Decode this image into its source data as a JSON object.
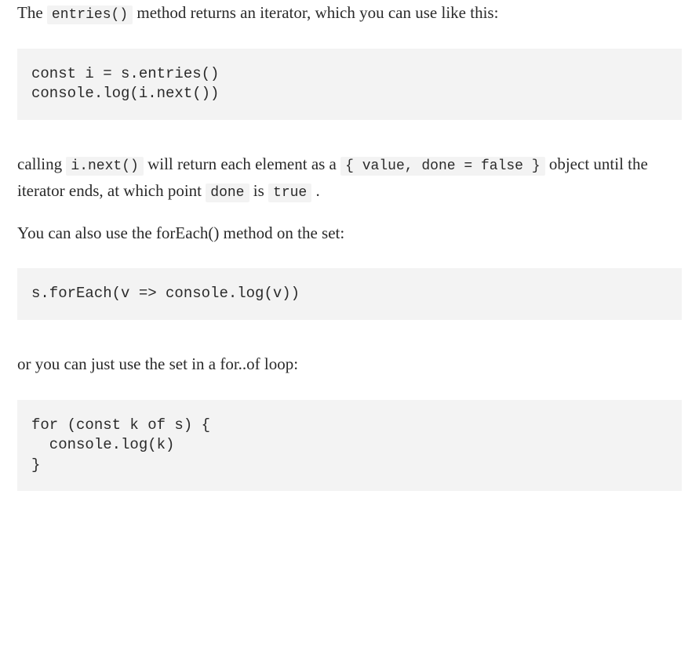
{
  "para1": {
    "text_before": "The ",
    "code1": "entries()",
    "text_after": " method returns an iterator, which you can use like this:"
  },
  "codeblock1": "const i = s.entries()\nconsole.log(i.next())",
  "para2": {
    "text_before": "calling ",
    "code1": "i.next()",
    "text_mid1": " will return each element as a ",
    "code2": "{ value, done = false }",
    "text_mid2": " object until the iterator ends, at which point ",
    "code3": "done",
    "text_mid3": " is ",
    "code4": "true",
    "text_after": " ."
  },
  "para3": "You can also use the forEach() method on the set:",
  "codeblock2": "s.forEach(v => console.log(v))",
  "para4": "or you can just use the set in a for..of loop:",
  "codeblock3": "for (const k of s) {\n  console.log(k)\n}"
}
